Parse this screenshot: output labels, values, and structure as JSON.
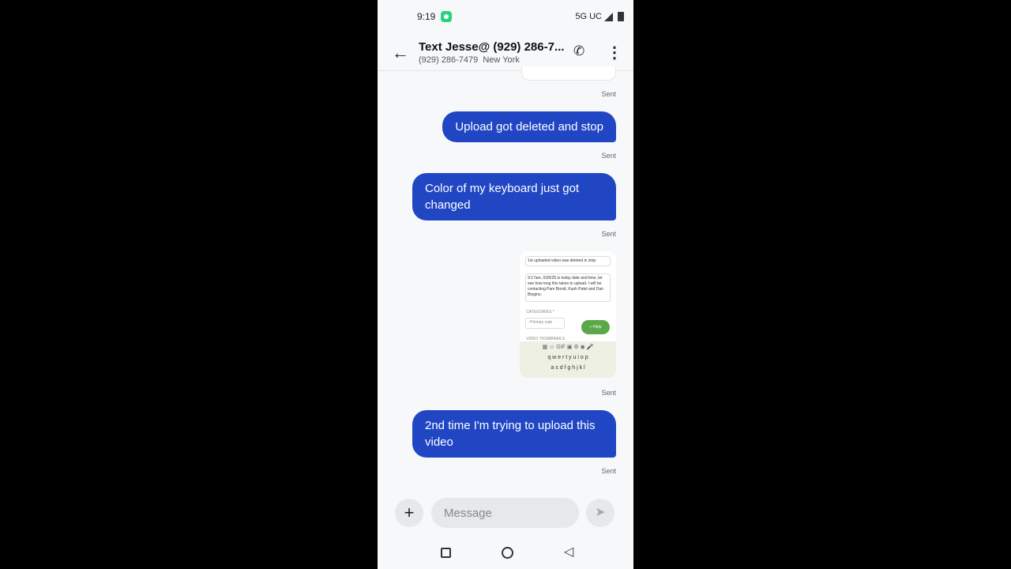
{
  "status": {
    "time": "9:19",
    "network": "5G UC"
  },
  "header": {
    "title": "Text Jesse@ (929) 286-7...",
    "phone": "(929) 286-7479",
    "location": "New York"
  },
  "messages": [
    {
      "text": "Upload got deleted and stop",
      "status": "Sent"
    },
    {
      "text": "Color of my keyboard just got changed",
      "status": "Sent"
    },
    {
      "type": "image",
      "status": "Sent",
      "image_text": {
        "title": "1st uploaded video was deleted in stop",
        "description": "9:17am, 02/6/25 is today date and time, let see how long this takes to upload. I will be contacting Pam Bondi, Kash Patel and Dan Bingino.",
        "categories": "CATEGORIES *",
        "primary": "- Primary cate",
        "help": "Help",
        "thumbs": "VIDEO THUMBNAILS",
        "row1": "q w e r t y u i o p",
        "row2": "a s d f g h j k l"
      }
    },
    {
      "text": "2nd time I'm trying to upload this video",
      "status": "Sent"
    }
  ],
  "first_status": "Sent",
  "compose": {
    "placeholder": "Message"
  },
  "colors": {
    "bubble": "#2146c4",
    "background": "#f7f8fa"
  }
}
